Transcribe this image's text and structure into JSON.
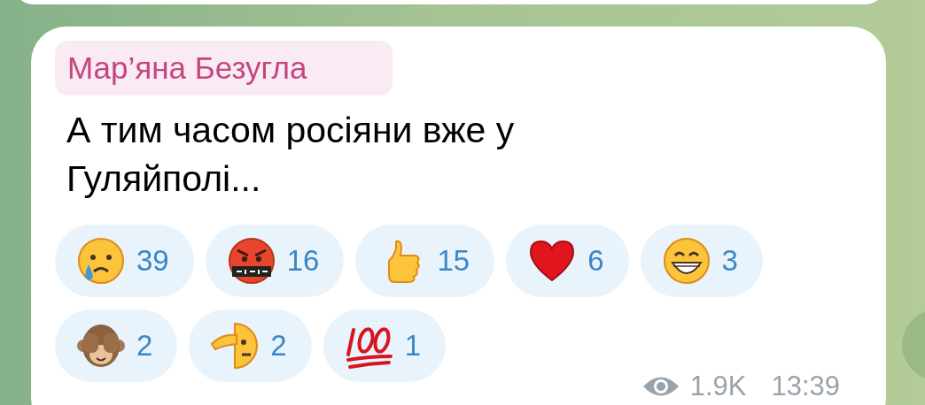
{
  "message": {
    "author": "Мар’яна Безугла",
    "text": "А тим часом росіяни вже у Гуляйполі...",
    "reactions": [
      {
        "kind": "crying",
        "count": "39"
      },
      {
        "kind": "cursing",
        "count": "16"
      },
      {
        "kind": "thumbs-up",
        "count": "15"
      },
      {
        "kind": "heart",
        "count": "6"
      },
      {
        "kind": "grin",
        "count": "3"
      },
      {
        "kind": "monkey",
        "count": "2"
      },
      {
        "kind": "salute",
        "count": "2"
      },
      {
        "kind": "hundred",
        "count": "1"
      }
    ],
    "views": "1.9K",
    "time": "13:39"
  }
}
